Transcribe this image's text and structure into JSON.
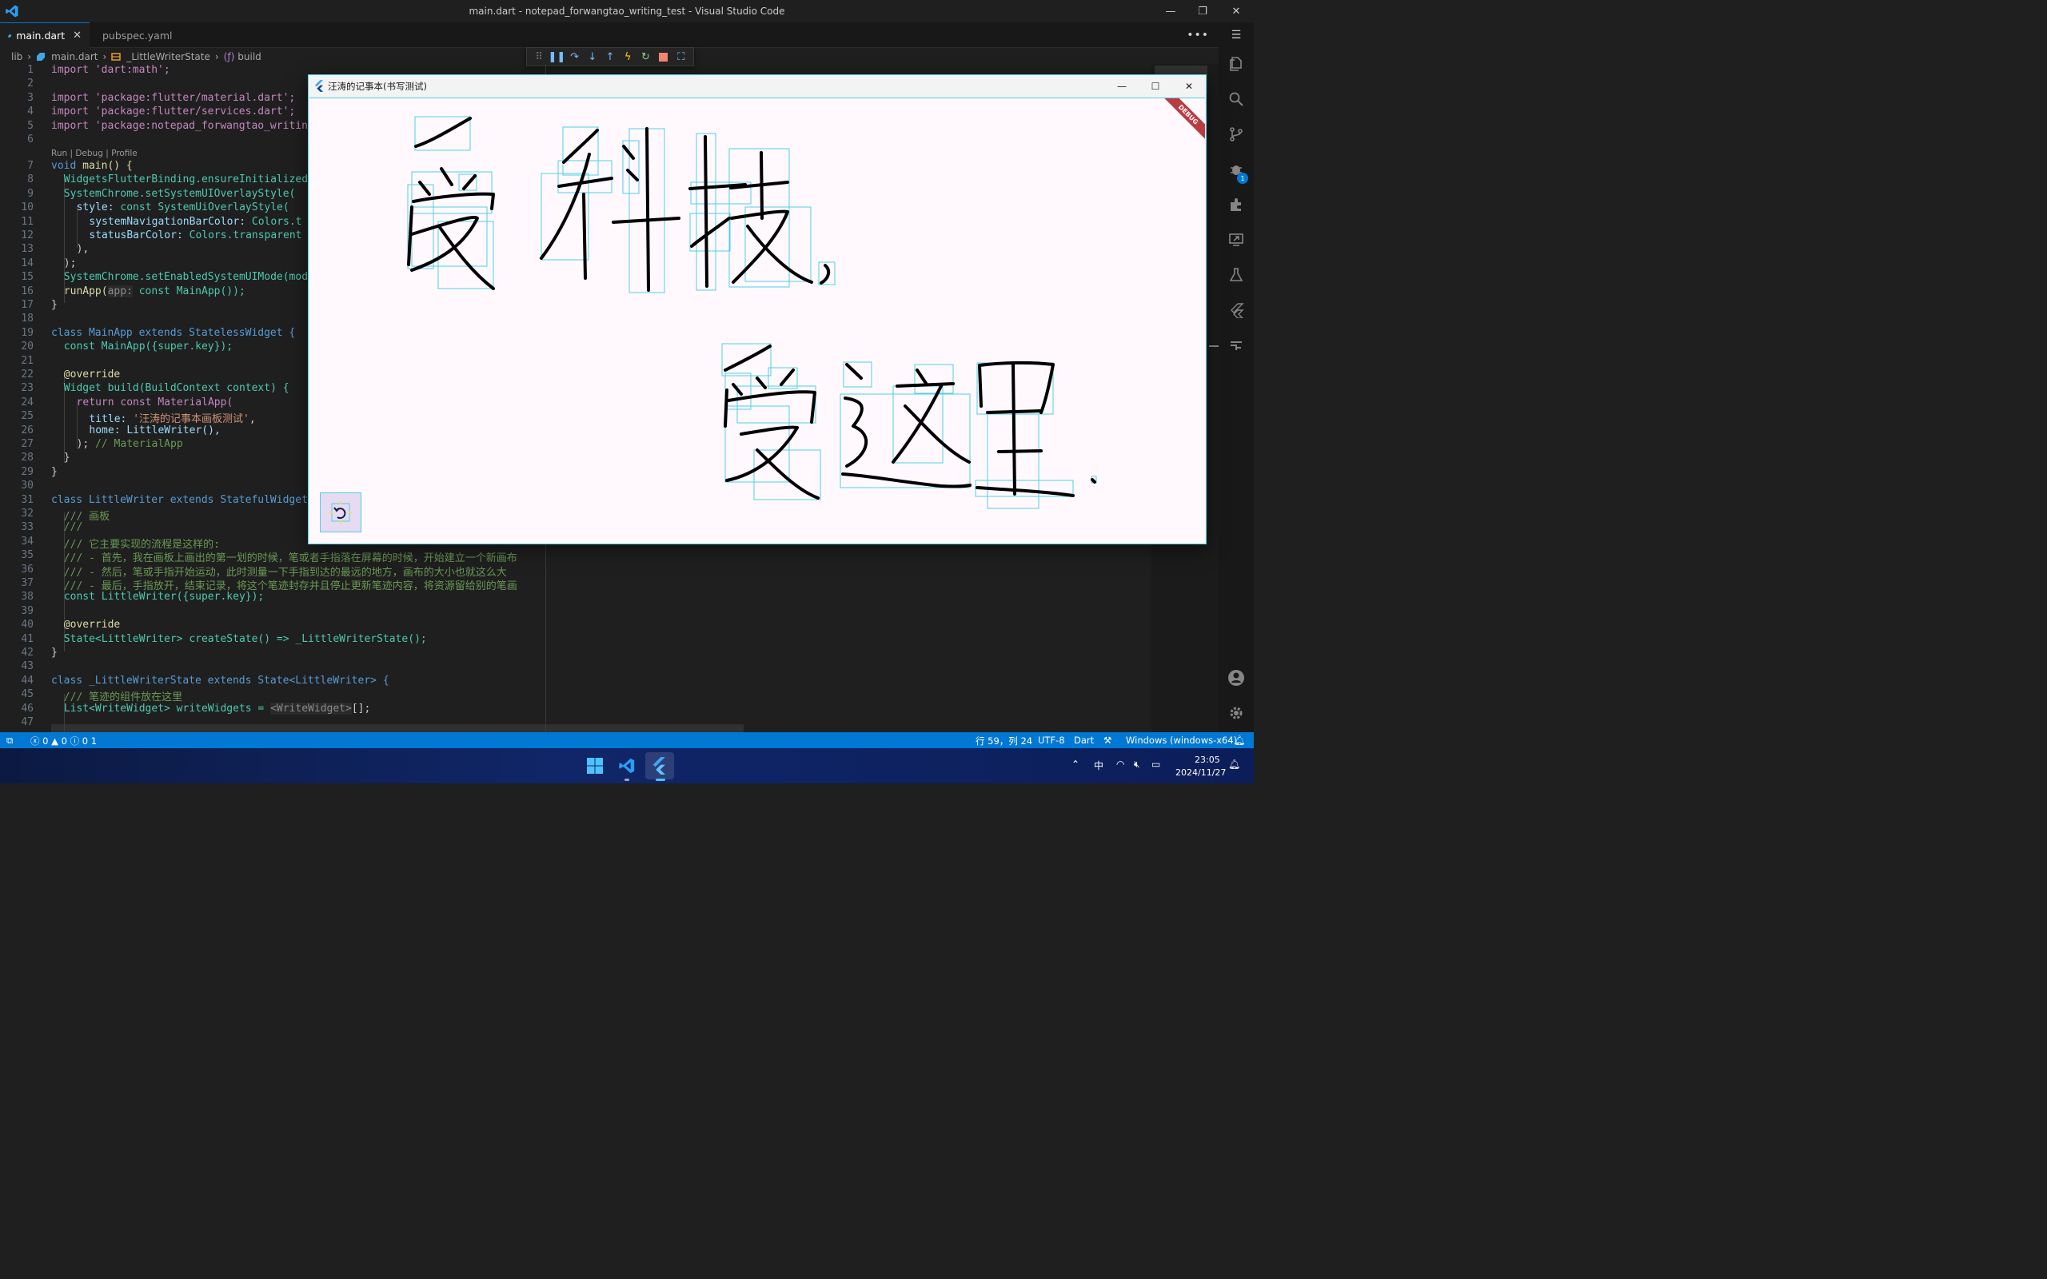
{
  "window": {
    "title": "main.dart - notepad_forwangtao_writing_test - Visual Studio Code"
  },
  "tabs": [
    {
      "label": "main.dart",
      "active": true
    },
    {
      "label": "pubspec.yaml",
      "active": false
    }
  ],
  "breadcrumb": [
    "lib",
    "main.dart",
    "_LittleWriterState",
    "build"
  ],
  "codelens": "Run | Debug | Profile",
  "code_lines": [
    "1",
    "2",
    "3",
    "4",
    "5",
    "6",
    "7",
    "8",
    "9",
    "10",
    "11",
    "12",
    "13",
    "14",
    "15",
    "16",
    "17",
    "18",
    "19",
    "20",
    "21",
    "22",
    "23",
    "24",
    "25",
    "26",
    "27",
    "28",
    "29",
    "30",
    "31",
    "32",
    "33",
    "34",
    "35",
    "36",
    "37",
    "38",
    "39",
    "40",
    "41",
    "42",
    "43",
    "44",
    "45",
    "46",
    "47"
  ],
  "code": {
    "l1": "import 'dart:math';",
    "l3": "import 'package:flutter/material.dart';",
    "l4": "import 'package:flutter/services.dart';",
    "l5": "import 'package:notepad_forwangtao_writing",
    "l7a": "void",
    "l7b": " main() {",
    "l8": "WidgetsFlutterBinding.ensureInitialized(",
    "l9": "SystemChrome.setSystemUIOverlayStyle(",
    "l10a": "style:",
    "l10b": " const SystemUiOverlayStyle(",
    "l11": "systemNavigationBarColor: ",
    "l11b": "Colors.t",
    "l12": "statusBarColor: ",
    "l12b": "Colors.transparent",
    "l13": "),",
    "l14": ");",
    "l15": "SystemChrome.setEnabledSystemUIMode(mode",
    "l16a": "runApp(",
    "l16b": "app:",
    "l16c": " const MainApp());",
    "l17": "}",
    "l19": "class MainApp extends StatelessWidget {",
    "l20": "const MainApp({super.key});",
    "l22": "@override",
    "l23": "Widget build(BuildContext context) {",
    "l24": "return const MaterialApp(",
    "l25a": "title: ",
    "l25b": "'汪涛的记事本画板测试'",
    "l25c": ",",
    "l26": "home: LittleWriter(),",
    "l27a": "); ",
    "l27b": "// MaterialApp",
    "l28": "}",
    "l29": "}",
    "l31": "class LittleWriter extends StatefulWidget",
    "l32": "/// 画板",
    "l33": "///",
    "l34": "/// 它主要实现的流程是这样的:",
    "l35": "/// - 首先，我在画板上画出的第一划的时候，笔或者手指落在屏幕的时候，开始建立一个新画布",
    "l36": "/// - 然后，笔或手指开始运动，此时测量一下手指到达的最远的地方，画布的大小也就这么大",
    "l37": "/// - 最后，手指放开，结束记录，将这个笔迹封存并且停止更新笔迹内容，将资源留给别的笔画",
    "l38": "const LittleWriter({super.key});",
    "l40": "@override",
    "l41": "State<LittleWriter> createState() => _LittleWriterState();",
    "l42": "}",
    "l44": "class _LittleWriterState extends State<LittleWriter> {",
    "l45": "/// 笔迹的组件放在这里",
    "l46a": "List<WriteWidget> writeWidgets = ",
    "l46b": "<WriteWidget>",
    "l46c": "[];"
  },
  "app": {
    "title": "汪涛的记事本(书写测试)",
    "debug_banner": "DEBUG"
  },
  "statusbar": {
    "problems": "0",
    "warnings": "0",
    "info": "0",
    "ports": "1",
    "cursor": "行 59，列 24",
    "encoding": "UTF-8",
    "language": "Dart",
    "device": "Windows (windows-x64)"
  },
  "taskbar": {
    "ime": "中",
    "time": "23:05",
    "date": "2024/11/27"
  },
  "icons": [
    "vscode-logo-icon",
    "flutter-logo-icon",
    "explorer-icon",
    "search-icon",
    "source-control-icon",
    "run-debug-icon",
    "extensions-icon",
    "remote-explorer-icon",
    "testing-icon",
    "flutter-icon",
    "accounts-icon",
    "manage-icon",
    "windows-start-icon"
  ],
  "colors": {
    "accent": "#0078d4",
    "statusbar": "#0078d4",
    "box": "#4fd0e8",
    "ink": "#000000"
  }
}
